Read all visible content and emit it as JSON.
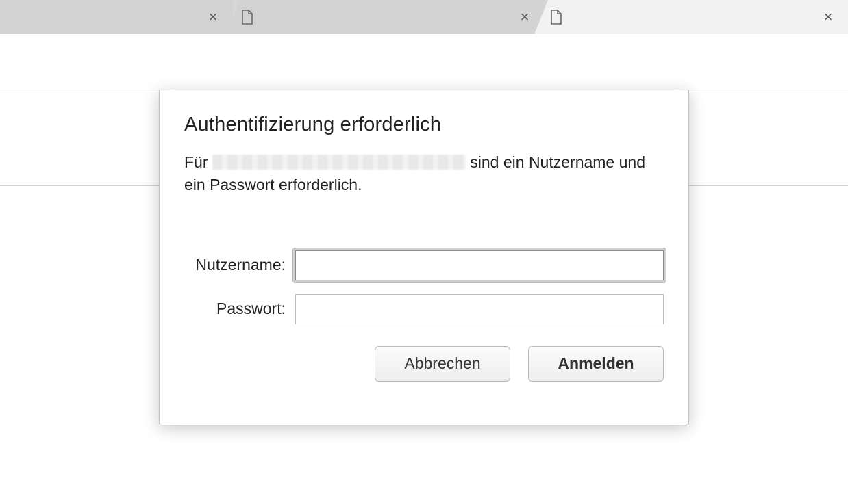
{
  "tabs": [
    {
      "title": "",
      "active": false
    },
    {
      "title": "",
      "active": false
    },
    {
      "title": "",
      "active": true
    }
  ],
  "dialog": {
    "title": "Authentifizierung erforderlich",
    "message_prefix": "Für ",
    "message_suffix": " sind ein Nutzername und ein Passwort erforderlich.",
    "username_label": "Nutzername:",
    "password_label": "Passwort:",
    "username_value": "",
    "password_value": "",
    "cancel_label": "Abbrechen",
    "submit_label": "Anmelden"
  }
}
